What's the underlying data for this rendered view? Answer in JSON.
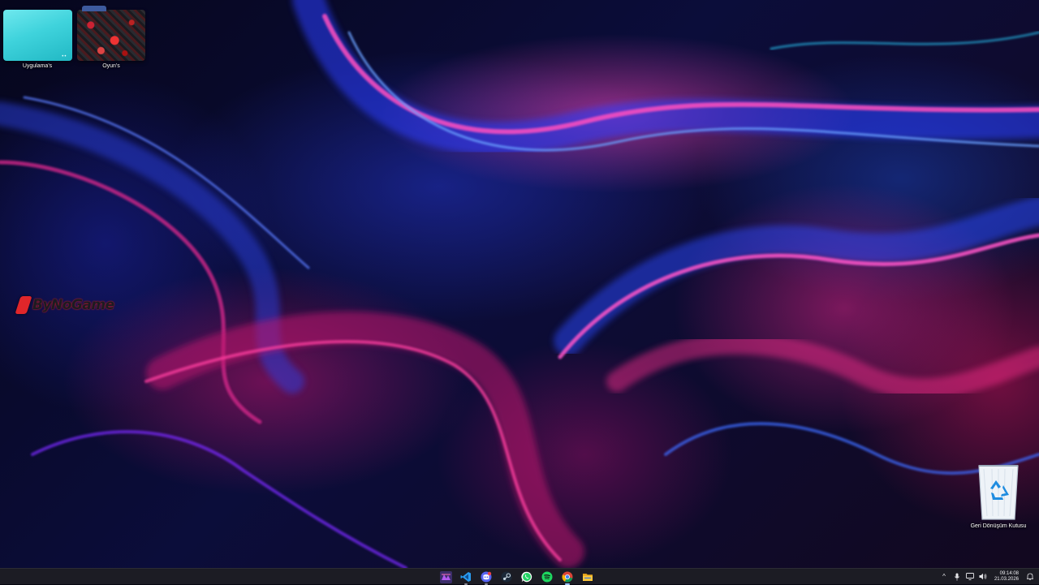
{
  "desktop": {
    "icons": [
      {
        "label": "Uygulama's"
      },
      {
        "label": "Oyun's"
      },
      {
        "label": "Geri Dönüşüm Kutusu"
      }
    ],
    "brand_logo": "ByNoGame",
    "folder_dots": "••"
  },
  "taskbar": {
    "apps": [
      {
        "name": "Start"
      },
      {
        "name": "Visual Studio Code"
      },
      {
        "name": "Discord"
      },
      {
        "name": "Steam"
      },
      {
        "name": "WhatsApp"
      },
      {
        "name": "Spotify"
      },
      {
        "name": "Google Chrome"
      },
      {
        "name": "File Explorer"
      }
    ],
    "tray": {
      "overflow_glyph": "^",
      "clock_time": "09:14:08",
      "clock_date": "21.03.2026"
    }
  },
  "colors": {
    "taskbar_bg": "#1c1c24",
    "wallpaper_pink": "#ff3fae",
    "wallpaper_blue": "#2f5bff",
    "folder_cyan": "#3fd3dc",
    "logo_red": "#e0262a"
  }
}
